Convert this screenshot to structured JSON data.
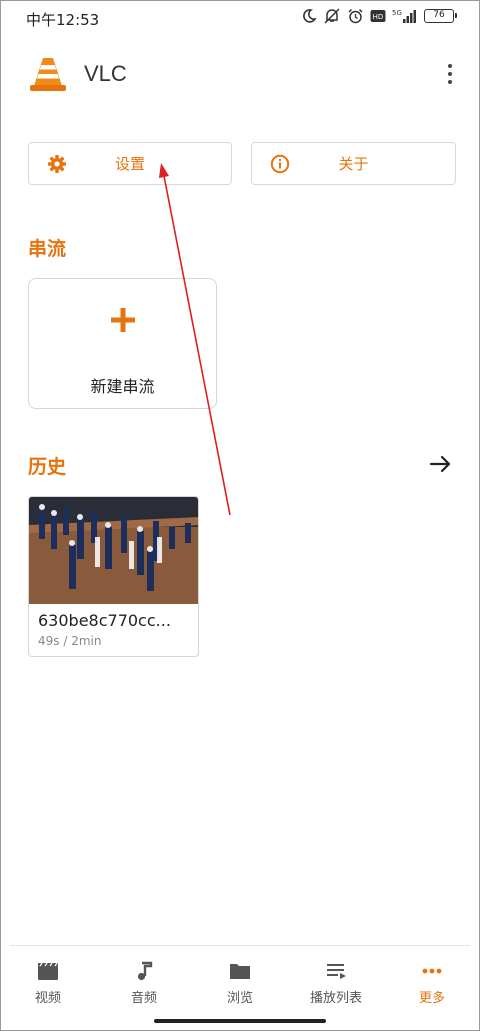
{
  "status_bar": {
    "time": "中午12:53",
    "battery": "76",
    "network": "5G"
  },
  "header": {
    "title": "VLC"
  },
  "actions": {
    "settings_label": "设置",
    "about_label": "关于"
  },
  "streams": {
    "section_title": "串流",
    "new_stream_label": "新建串流"
  },
  "history": {
    "section_title": "历史",
    "items": [
      {
        "title": "630be8c770cc...",
        "meta": "49s / 2min"
      }
    ]
  },
  "bottom_nav": {
    "items": [
      {
        "label": "视频",
        "icon": "video-icon",
        "active": false
      },
      {
        "label": "音频",
        "icon": "music-icon",
        "active": false
      },
      {
        "label": "浏览",
        "icon": "folder-icon",
        "active": false
      },
      {
        "label": "播放列表",
        "icon": "playlist-icon",
        "active": false
      },
      {
        "label": "更多",
        "icon": "more-icon",
        "active": true
      }
    ]
  },
  "colors": {
    "accent": "#e8730c",
    "annotation_arrow": "#e02020"
  }
}
